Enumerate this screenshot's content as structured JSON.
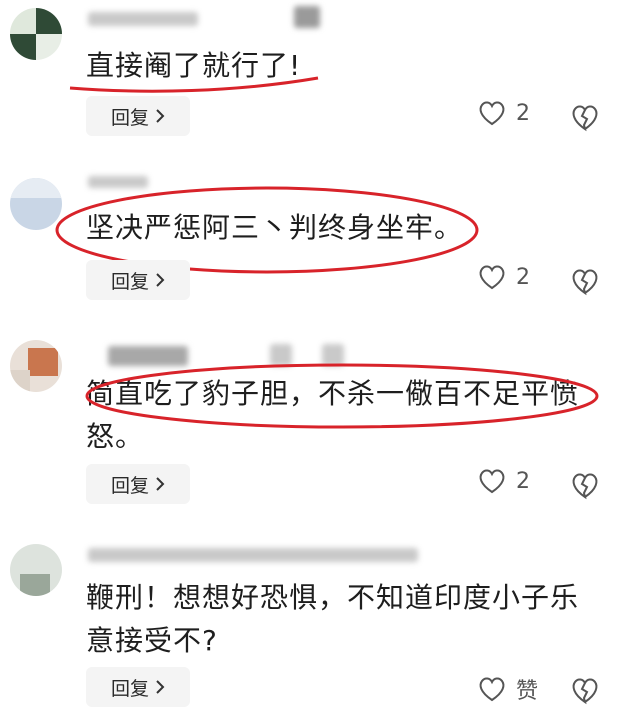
{
  "comments": [
    {
      "text": "直接阉了就行了!",
      "reply_label": "回复",
      "likes": "2"
    },
    {
      "text": "坚决严惩阿三丶判终身坐牢。",
      "reply_label": "回复",
      "likes": "2"
    },
    {
      "text": "简直吃了豹子胆，不杀一儆百不足平愤怒。",
      "reply_label": "回复",
      "likes": "2"
    },
    {
      "text": "鞭刑！想想好恐惧，不知道印度小子乐意接受不?",
      "reply_label": "回复",
      "likes": "赞"
    }
  ],
  "icons": {
    "chevron": "chevron-right-icon",
    "heart": "heart-icon",
    "broken_heart": "broken-heart-icon"
  },
  "colors": {
    "annotation": "#d8232a",
    "button_bg": "#f4f4f4"
  }
}
